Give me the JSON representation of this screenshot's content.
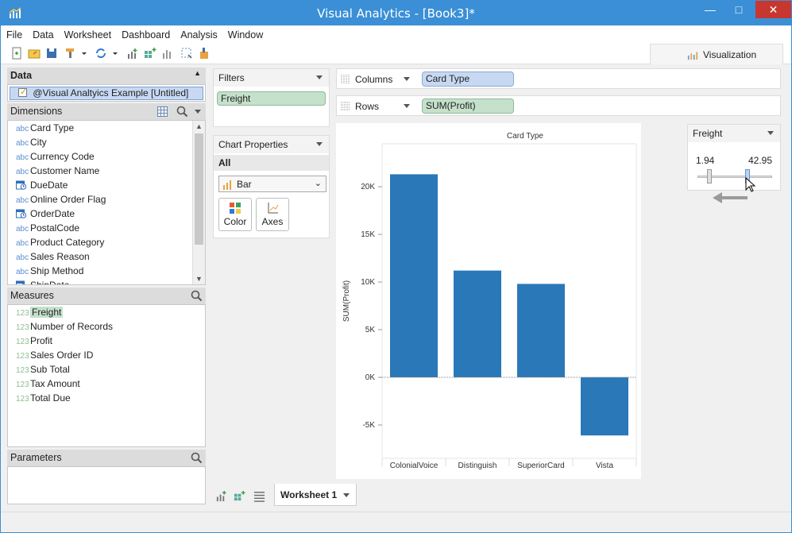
{
  "window": {
    "title": "Visual Analytics - [Book3]*"
  },
  "menu": [
    "File",
    "Data",
    "Worksheet",
    "Dashboard",
    "Analysis",
    "Window"
  ],
  "toolbar_right": {
    "tab_label": "Visualization"
  },
  "data_panel": {
    "header": "Data",
    "source": "@Visual Analtyics Example [Untitled]"
  },
  "dimensions": {
    "header": "Dimensions",
    "items": [
      {
        "type": "abc",
        "label": "Card Type"
      },
      {
        "type": "abc",
        "label": "City"
      },
      {
        "type": "abc",
        "label": "Currency Code"
      },
      {
        "type": "abc",
        "label": "Customer Name"
      },
      {
        "type": "date",
        "label": "DueDate"
      },
      {
        "type": "abc",
        "label": "Online Order Flag"
      },
      {
        "type": "date",
        "label": "OrderDate"
      },
      {
        "type": "abc",
        "label": "PostalCode"
      },
      {
        "type": "abc",
        "label": "Product Category"
      },
      {
        "type": "abc",
        "label": "Sales Reason"
      },
      {
        "type": "abc",
        "label": "Ship Method"
      },
      {
        "type": "date",
        "label": "ShipDate"
      }
    ]
  },
  "measures": {
    "header": "Measures",
    "items": [
      {
        "type": "123",
        "label": "Freight",
        "selected": true
      },
      {
        "type": "123",
        "label": "Number of Records"
      },
      {
        "type": "123",
        "label": "Profit"
      },
      {
        "type": "123",
        "label": "Sales Order ID"
      },
      {
        "type": "123",
        "label": "Sub Total"
      },
      {
        "type": "123",
        "label": "Tax Amount"
      },
      {
        "type": "123",
        "label": "Total Due"
      }
    ]
  },
  "parameters": {
    "header": "Parameters"
  },
  "filters": {
    "header": "Filters",
    "pill": "Freight"
  },
  "chart_properties": {
    "header": "Chart Properties",
    "section": "All",
    "chart_type": "Bar",
    "color_label": "Color",
    "axes_label": "Axes"
  },
  "shelves": {
    "columns_label": "Columns",
    "columns_pill": "Card Type",
    "rows_label": "Rows",
    "rows_pill": "SUM(Profit)"
  },
  "freight_filter": {
    "header": "Freight",
    "min": "1.94",
    "max": "42.95"
  },
  "tabs": {
    "active": "Worksheet 1"
  },
  "colors": {
    "bar": "#2a78b8",
    "titlebar": "#3a8fd6"
  },
  "chart_data": {
    "type": "bar",
    "title": "Card Type",
    "xlabel": "",
    "ylabel": "SUM(Profit)",
    "categories": [
      "ColonialVoice",
      "Distinguish",
      "SuperiorCard",
      "Vista"
    ],
    "values": [
      21300,
      11200,
      9800,
      -6100
    ],
    "ylim": [
      -8500,
      24500
    ],
    "yticks": [
      -5000,
      0,
      5000,
      10000,
      15000,
      20000
    ],
    "ytick_labels": [
      "-5K",
      "0K",
      "5K",
      "10K",
      "15K",
      "20K"
    ]
  }
}
